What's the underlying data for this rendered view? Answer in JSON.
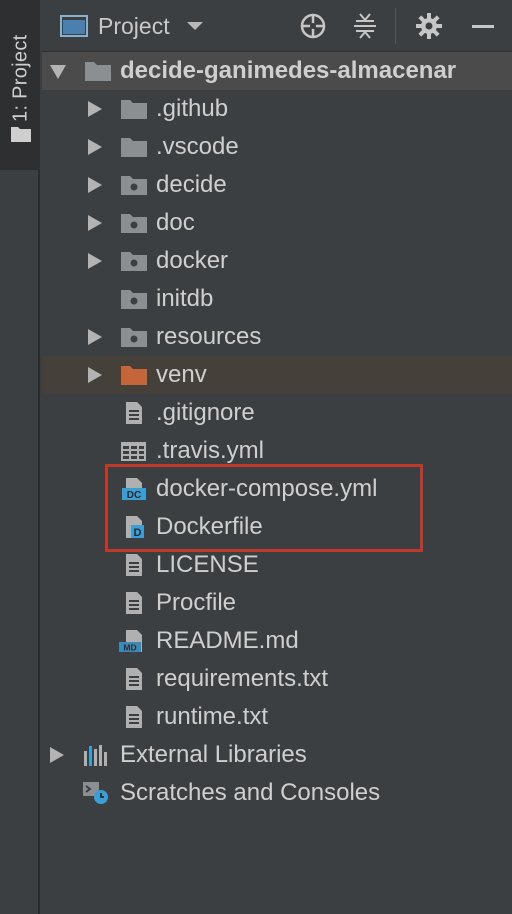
{
  "stripe": {
    "tab_label": "1: Project"
  },
  "header": {
    "view_label": "Project"
  },
  "tree": {
    "root": "decide-ganimedes-almacenar",
    "items": [
      {
        "label": ".github",
        "type": "folder"
      },
      {
        "label": ".vscode",
        "type": "folder"
      },
      {
        "label": "decide",
        "type": "module-folder"
      },
      {
        "label": "doc",
        "type": "module-folder"
      },
      {
        "label": "docker",
        "type": "module-folder"
      },
      {
        "label": "initdb",
        "type": "module-folder"
      },
      {
        "label": "resources",
        "type": "module-folder"
      },
      {
        "label": "venv",
        "type": "excluded-folder"
      },
      {
        "label": ".gitignore",
        "type": "text-file"
      },
      {
        "label": ".travis.yml",
        "type": "yaml-file"
      },
      {
        "label": "docker-compose.yml",
        "type": "docker-compose-file"
      },
      {
        "label": "Dockerfile",
        "type": "dockerfile"
      },
      {
        "label": "LICENSE",
        "type": "text-file"
      },
      {
        "label": "Procfile",
        "type": "text-file"
      },
      {
        "label": "README.md",
        "type": "markdown-file"
      },
      {
        "label": "requirements.txt",
        "type": "text-file"
      },
      {
        "label": "runtime.txt",
        "type": "text-file"
      }
    ],
    "external_libraries": "External Libraries",
    "scratches": "Scratches and Consoles"
  },
  "colors": {
    "background": "#3c3f41",
    "venv_folder": "#c5653a",
    "highlight_border": "#c0392b",
    "docker_blue": "#3b9fd6"
  }
}
